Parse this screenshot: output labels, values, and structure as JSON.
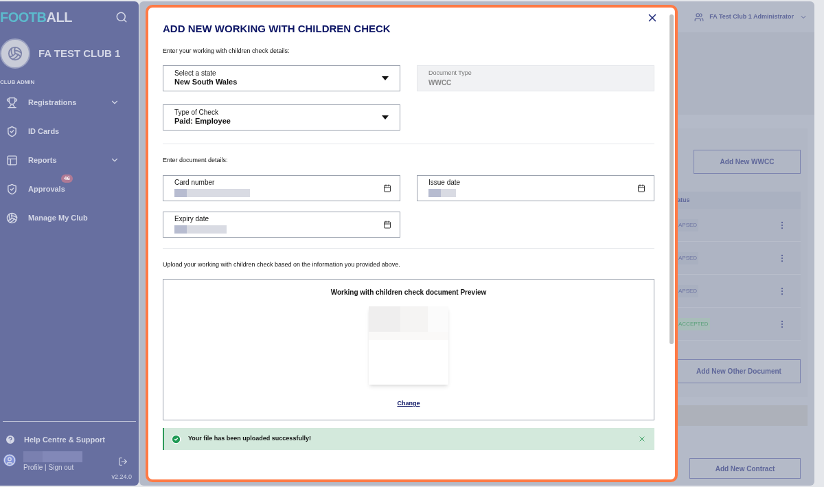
{
  "sidebar": {
    "logo": {
      "accent": "FOOTB",
      "rest": "ALL"
    },
    "club_name": "FA TEST CLUB 1",
    "section": "CLUB ADMIN",
    "items": [
      {
        "label": "Registrations",
        "expandable": true
      },
      {
        "label": "ID Cards",
        "expandable": false
      },
      {
        "label": "Reports",
        "expandable": true
      },
      {
        "label": "Approvals",
        "expandable": false,
        "badge": "46"
      },
      {
        "label": "Manage My Club",
        "expandable": false
      }
    ],
    "help": "Help Centre & Support",
    "profile_links": "Profile | Sign out",
    "version": "v2.24.0"
  },
  "header": {
    "user": "FA Test Club 1 Administrator"
  },
  "background": {
    "add_wwcc": "Add New WWCC",
    "table_header": "atus",
    "rows": [
      {
        "status": "APSED",
        "kind": "lapsed"
      },
      {
        "status": "APSED",
        "kind": "lapsed"
      },
      {
        "status": "APSED",
        "kind": "lapsed"
      },
      {
        "status": "ACCEPTED",
        "kind": "accepted"
      }
    ],
    "add_other": "Add New Other Document",
    "add_contract": "Add New Contract"
  },
  "modal": {
    "title": "ADD NEW WORKING WITH CHILDREN CHECK",
    "intro": "Enter your working with children check details:",
    "state": {
      "label": "Select a state",
      "value": "New South Wales"
    },
    "document_type": {
      "label": "Document Type",
      "value": "WWCC",
      "disabled": true
    },
    "check_type": {
      "label": "Type of Check",
      "value": "Paid: Employee"
    },
    "details_heading": "Enter document details:",
    "card_number": {
      "label": "Card number"
    },
    "issue_date": {
      "label": "Issue date"
    },
    "expiry_date": {
      "label": "Expiry date"
    },
    "upload_text": "Upload your working with children check based on the information you provided above.",
    "preview_title": "Working with children check document Preview",
    "change_link": "Change",
    "success": "Your file has been uploaded successfully!"
  }
}
